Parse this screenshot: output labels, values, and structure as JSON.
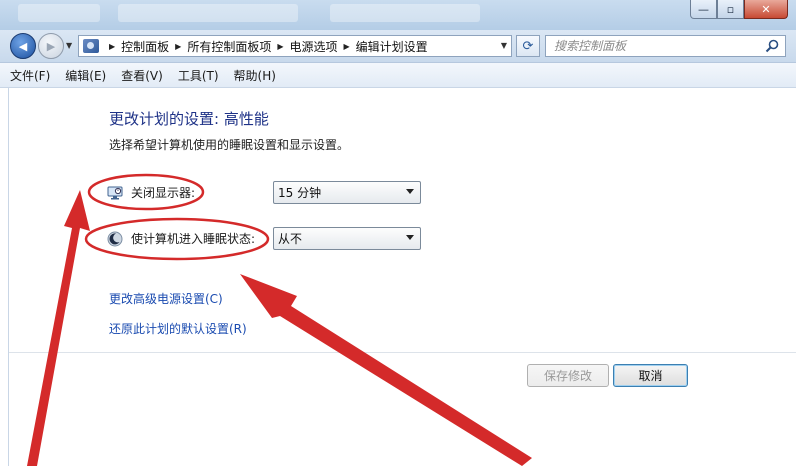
{
  "titlebar": {
    "ghost_tabs": [
      "",
      "",
      ""
    ],
    "buttons": {
      "minimize": "—",
      "maximize": "▫",
      "close": "✕"
    }
  },
  "nav": {
    "back_glyph": "◀",
    "forward_glyph": "▶",
    "breadcrumbs": [
      "控制面板",
      "所有控制面板项",
      "电源选项",
      "编辑计划设置"
    ],
    "search_placeholder": "搜索控制面板",
    "refresh_glyph": "⟳"
  },
  "menu": {
    "items": [
      "文件(F)",
      "编辑(E)",
      "查看(V)",
      "工具(T)",
      "帮助(H)"
    ]
  },
  "main": {
    "title": "更改计划的设置: 高性能",
    "subtitle": "选择希望计算机使用的睡眠设置和显示设置。",
    "settings": [
      {
        "label": "关闭显示器:",
        "value": "15 分钟",
        "icon": "monitor-icon"
      },
      {
        "label": "使计算机进入睡眠状态:",
        "value": "从不",
        "icon": "moon-icon"
      }
    ],
    "links": [
      "更改高级电源设置(C)",
      "还原此计划的默认设置(R)"
    ],
    "buttons": {
      "save": "保存修改",
      "cancel": "取消"
    }
  },
  "colors": {
    "title_blue": "#1e3287",
    "link_blue": "#1a4bb0",
    "annotation_red": "#d42a2a"
  }
}
